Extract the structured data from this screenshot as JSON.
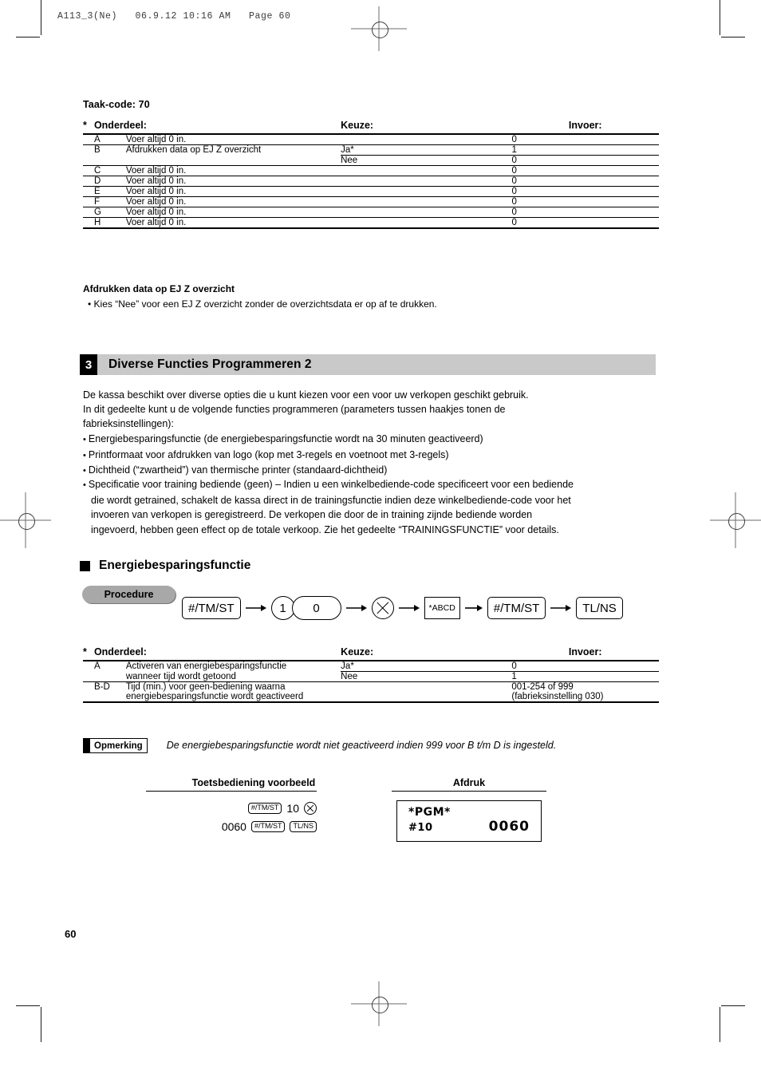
{
  "page_header": "A113_3(Ne)   06.9.12 10:16 AM   Page 60",
  "page_number": "60",
  "taak_code": "Taak-code:  70",
  "table1": {
    "star": "*",
    "headers": {
      "onderdeel": "Onderdeel:",
      "keuze": "Keuze:",
      "invoer": "Invoer:"
    },
    "rows": [
      {
        "id": "A",
        "desc": "Voer altijd 0 in.",
        "keuze": "",
        "invoer": "0"
      },
      {
        "id": "B",
        "desc": "Afdrukken data op EJ Z overzicht",
        "keuze": "Ja*",
        "invoer": "1"
      },
      {
        "id": "",
        "desc": "",
        "keuze": "Nee",
        "invoer": "0"
      },
      {
        "id": "C",
        "desc": "Voer altijd 0 in.",
        "keuze": "",
        "invoer": "0"
      },
      {
        "id": "D",
        "desc": "Voer altijd 0 in.",
        "keuze": "",
        "invoer": "0"
      },
      {
        "id": "E",
        "desc": "Voer altijd 0 in.",
        "keuze": "",
        "invoer": "0"
      },
      {
        "id": "F",
        "desc": "Voer altijd 0 in.",
        "keuze": "",
        "invoer": "0"
      },
      {
        "id": "G",
        "desc": "Voer altijd 0 in.",
        "keuze": "",
        "invoer": "0"
      },
      {
        "id": "H",
        "desc": "Voer altijd 0 in.",
        "keuze": "",
        "invoer": "0"
      }
    ]
  },
  "subnote": {
    "title": "Afdrukken data op EJ Z overzicht",
    "body": "• Kies “Nee” voor een EJ Z overzicht zonder de overzichtsdata er op af te drukken."
  },
  "section": {
    "number": "3",
    "title": "Diverse Functies Programmeren 2",
    "paragraph_line1": "De kassa beschikt over diverse opties die u kunt kiezen voor een voor uw verkopen geschikt gebruik.",
    "paragraph_line2": "In dit gedeelte kunt u de volgende functies programmeren (parameters tussen haakjes tonen de",
    "paragraph_line3": "fabrieksinstellingen):",
    "bullets": [
      "Energiebesparingsfunctie (de energiebesparingsfunctie wordt na 30 minuten geactiveerd)",
      "Printformaat voor afdrukken van logo (kop met 3-regels en voetnoot met 3-regels)",
      "Dichtheid (“zwartheid”) van thermische printer (standaard-dichtheid)"
    ],
    "bullet_long": {
      "l1": "Specificatie voor training bediende (geen) – Indien u een winkelbediende-code specificeert voor een bediende",
      "l2": "die wordt getrained, schakelt de kassa direct in de trainingsfunctie indien deze winkelbediende-code voor het",
      "l3": "invoeren van verkopen is geregistreerd. De verkopen die door de in training zijnde bediende worden",
      "l4": "ingevoerd, hebben geen effect op de totale verkoop. Zie het gedeelte “TRAININGSFUNCTIE” voor details."
    }
  },
  "subsection": {
    "heading": "Energiebesparingsfunctie",
    "procedure_label": "Procedure",
    "procedure_keys": [
      {
        "type": "keybox",
        "label": "#/TM/ST"
      },
      {
        "type": "arrow",
        "label": "→"
      },
      {
        "type": "circle",
        "label": "1"
      },
      {
        "type": "pill",
        "label": "0"
      },
      {
        "type": "arrow",
        "label": "→"
      },
      {
        "type": "multiply",
        "label": "⊗"
      },
      {
        "type": "arrow",
        "label": "→"
      },
      {
        "type": "square",
        "label": "*ABCD"
      },
      {
        "type": "arrow",
        "label": "→"
      },
      {
        "type": "keybox",
        "label": "#/TM/ST"
      },
      {
        "type": "arrow",
        "label": "→"
      },
      {
        "type": "keybox",
        "label": "TL/NS"
      }
    ]
  },
  "table2": {
    "star": "*",
    "headers": {
      "onderdeel": "Onderdeel:",
      "keuze": "Keuze:",
      "invoer": "Invoer:"
    },
    "rows": [
      {
        "id": "A",
        "desc_l1": "Activeren van energiebesparingsfunctie",
        "desc_l2": "wanneer tijd wordt getoond",
        "keuze1": "Ja*",
        "invoer1": "0",
        "keuze2": "Nee",
        "invoer2": "1"
      },
      {
        "id": "B-D",
        "desc_l1": "Tijd (min.) voor geen-bediening waarna",
        "desc_l2": "energiebesparingsfunctie wordt geactiveerd",
        "invoer1": "001-254 of 999",
        "invoer2": "(fabrieksinstelling 030)"
      }
    ]
  },
  "note": {
    "badge": "Opmerking",
    "text": "De energiebesparingsfunctie wordt niet geactiveerd indien 999 voor B t/m D is ingesteld."
  },
  "example": {
    "left_title": "Toetsbediening voorbeeld",
    "right_title": "Afdruk",
    "keys_line1": [
      {
        "type": "key",
        "label": "#/TM/ST"
      },
      {
        "type": "num",
        "label": "10"
      },
      {
        "type": "multiply",
        "label": "⊗"
      }
    ],
    "keys_line2": [
      {
        "type": "num",
        "label": "0060"
      },
      {
        "type": "key",
        "label": "#/TM/ST"
      },
      {
        "type": "key",
        "label": "TL/NS"
      }
    ],
    "receipt": {
      "line1": "*PGM*",
      "line2_left": "#10",
      "line2_right": "0060"
    }
  }
}
